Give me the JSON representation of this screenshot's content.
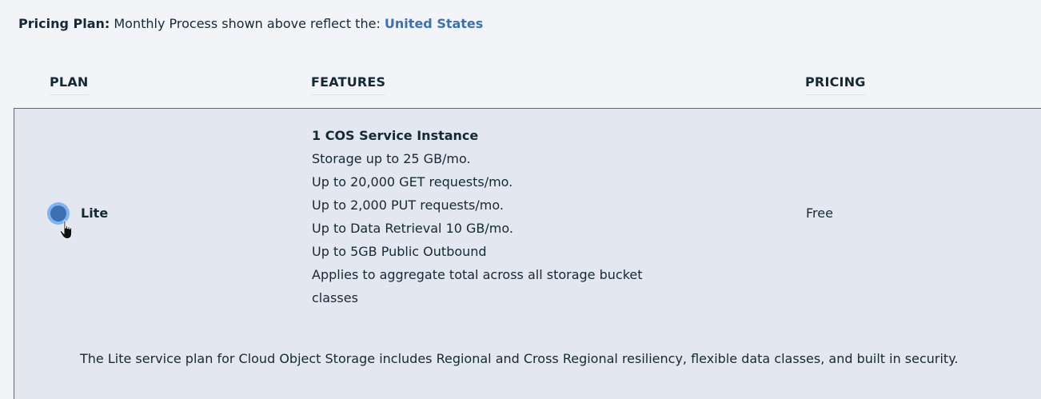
{
  "pricing_note": {
    "label": "Pricing Plan:",
    "text": "Monthly Process shown above reflect the:",
    "region": "United States"
  },
  "table": {
    "headers": {
      "plan": "PLAN",
      "features": "FEATURES",
      "pricing": "PRICING"
    },
    "rows": [
      {
        "selected": true,
        "plan": "Lite",
        "features": {
          "title": "1 COS Service Instance",
          "items": [
            "Storage up to 25 GB/mo.",
            "Up to 20,000 GET requests/mo.",
            "Up to 2,000 PUT requests/mo.",
            "Up to Data Retrieval 10 GB/mo.",
            "Up to 5GB Public Outbound",
            "Applies to aggregate total across all storage bucket classes"
          ]
        },
        "price": "Free",
        "description": "The Lite service plan for Cloud Object Storage includes Regional and Cross Regional resiliency, flexible data classes, and built in security."
      }
    ]
  },
  "colors": {
    "accent": "#3d70b2",
    "row_selected_bg": "#e2e7f0",
    "radio_ring": "#7fb3f5",
    "text": "#152935"
  },
  "icons": {
    "cursor": "hand-pointer-icon"
  }
}
